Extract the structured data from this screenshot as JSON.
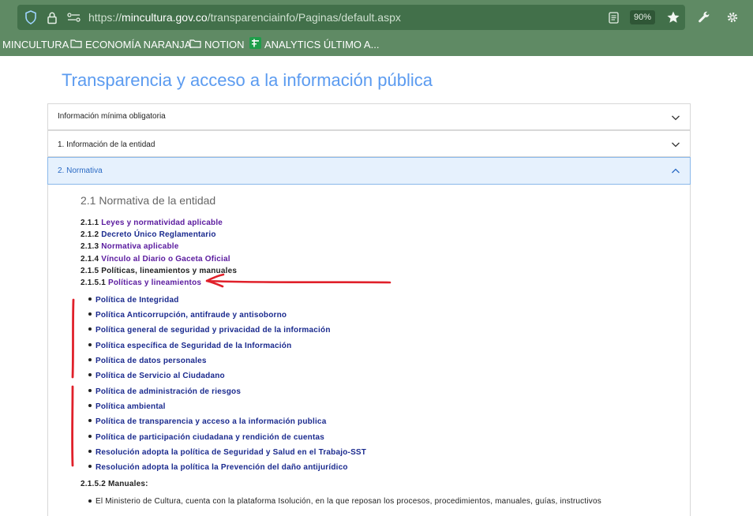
{
  "browser": {
    "url_prefix": "https://",
    "url_host": "mincultura.gov.co",
    "url_path": "/transparenciainfo/Paginas/default.aspx",
    "zoom": "90%",
    "icons": [
      "shield-icon",
      "lock-icon",
      "site-permissions-icon",
      "reader-view-icon",
      "bookmark-star-icon",
      "wrench-icon",
      "gear-icon"
    ],
    "bookmarks": [
      {
        "label": "MINCULTURA",
        "icon": "none"
      },
      {
        "label": "ECONOMÍA NARANJA",
        "icon": "folder-icon"
      },
      {
        "label": "NOTION",
        "icon": "folder-icon"
      },
      {
        "label": "ANALYTICS ÚLTIMO A...",
        "icon": "analytics-icon"
      }
    ],
    "colors": {
      "chrome": "#5f8a64",
      "urlbar": "#42704a"
    }
  },
  "page": {
    "title": "Transparencia y acceso a la información pública",
    "accordion": [
      {
        "label": "Información mínima obligatoria",
        "expanded": false
      },
      {
        "label": "1. Información de la entidad",
        "expanded": false
      },
      {
        "label": "2. Normativa",
        "expanded": true
      }
    ],
    "section_heading": "2.1 Normativa de la entidad",
    "items": [
      {
        "num": "2.1.1",
        "text": "Leyes y normatividad aplicable",
        "link": true
      },
      {
        "num": "2.1.2",
        "text": "Decreto Único Reglamentario",
        "link": true
      },
      {
        "num": "2.1.3",
        "text": "Normativa aplicable",
        "link": true
      },
      {
        "num": "2.1.4",
        "text": "Vínculo al Diario o Gaceta Oficial",
        "link": true
      },
      {
        "num": "2.1.5",
        "text": "Políticas, lineamientos y manuales",
        "link": false
      },
      {
        "num": "2.1.5.1",
        "text": "Políticas y lineamientos",
        "link": true
      }
    ],
    "policies": [
      "Política de Integridad",
      "Política Anticorrupción, antifraude y antisoborno",
      "Política general de seguridad y privacidad de la información",
      "Política específica de Seguridad de la Información",
      "Política de datos personales",
      "Política de Servicio al Ciudadano",
      "Política de administración de riesgos",
      "Política ambiental",
      "Política de transparencia y acceso a la información publica",
      "Política de participación ciudadana y rendición de cuentas",
      "Resolución adopta la política de Seguridad y Salud en el Trabajo-SST",
      "Resolución adopta la política la Prevención del daño antijurídico"
    ],
    "manuals_heading": "2.1.5.2 Manuales:",
    "manuals_text": "El Ministerio de Cultura, cuenta con la plataforma Isolución, en la que reposan los procesos, procedimientos, manuales, guías, instructivos"
  },
  "colors": {
    "title": "#5b9bf0",
    "link_visited": "#5a1a9e",
    "link": "#1a2a8e",
    "annotation": "#e0202a"
  }
}
